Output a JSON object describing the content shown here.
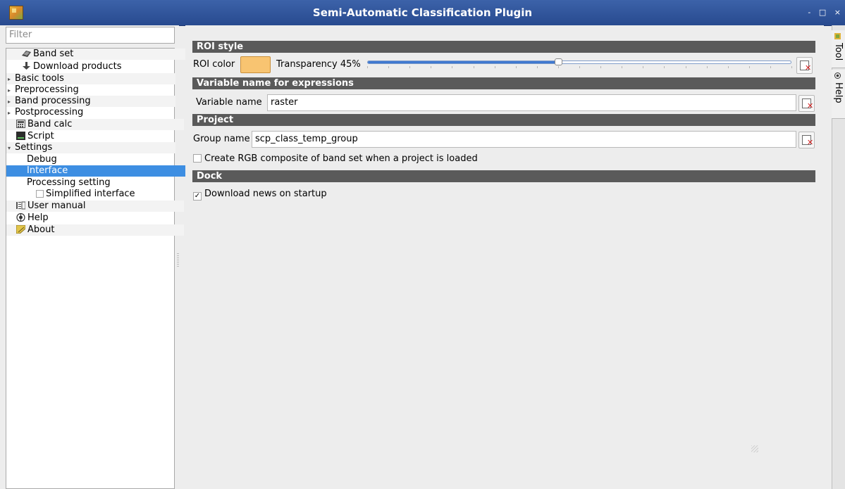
{
  "window": {
    "title": "Semi-Automatic Classification Plugin",
    "controls": "- □ ×"
  },
  "sidebar": {
    "filter_placeholder": "Filter",
    "items": [
      {
        "label": "Band set",
        "icon": "band-set-icon"
      },
      {
        "label": "Download products",
        "icon": "download-icon"
      },
      {
        "label": "Basic tools",
        "expandable": true
      },
      {
        "label": "Preprocessing",
        "expandable": true
      },
      {
        "label": "Band processing",
        "expandable": true
      },
      {
        "label": "Postprocessing",
        "expandable": true
      },
      {
        "label": "Band calc",
        "icon": "calculator-icon"
      },
      {
        "label": "Script",
        "icon": "script-icon"
      },
      {
        "label": "Settings",
        "expanded": true
      },
      {
        "label": "Debug"
      },
      {
        "label": "Interface",
        "selected": true
      },
      {
        "label": "Processing setting"
      },
      {
        "label": "Simplified interface",
        "checkbox": true,
        "checked": false
      },
      {
        "label": "User manual",
        "icon": "manual-icon"
      },
      {
        "label": "Help",
        "icon": "help-icon"
      },
      {
        "label": "About",
        "icon": "about-icon"
      }
    ]
  },
  "main": {
    "roi_style": {
      "header": "ROI style",
      "roi_color_label": "ROI color",
      "roi_color": "#f8c471",
      "transparency_label": "Transparency 45%",
      "transparency_value": 45
    },
    "variable": {
      "header": "Variable name for expressions",
      "label": "Variable name",
      "value": "raster"
    },
    "project": {
      "header": "Project",
      "group_label": "Group name",
      "group_value": "scp_class_temp_group",
      "rgb_composite_label": "Create RGB composite of band set when a project is loaded",
      "rgb_composite_checked": false
    },
    "dock": {
      "header": "Dock",
      "download_news_label": "Download news on startup",
      "download_news_checked": true
    }
  },
  "right_tabs": [
    {
      "label": "Tool",
      "icon": "tool-icon"
    },
    {
      "label": "Help",
      "icon": "help-icon"
    }
  ]
}
